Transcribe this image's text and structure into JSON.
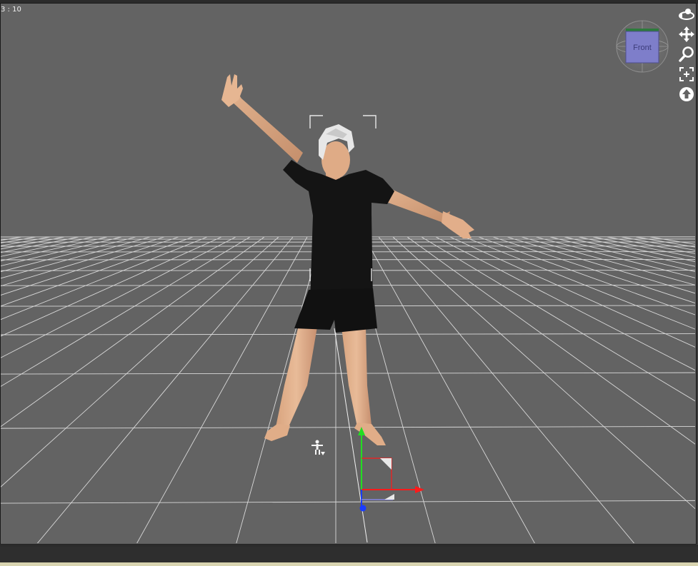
{
  "viewport": {
    "fps_text": "3 : 10",
    "view_cube_label": "Front",
    "background_color": "#636363",
    "grid_color": "#d6d6d6"
  },
  "nav_tools": [
    {
      "name": "orbit-icon",
      "icon": "orbit"
    },
    {
      "name": "pan-icon",
      "icon": "move-arrows"
    },
    {
      "name": "zoom-icon",
      "icon": "magnifier"
    },
    {
      "name": "frame-icon",
      "icon": "frame-brackets"
    },
    {
      "name": "reset-view-icon",
      "icon": "up-arrow-circle"
    }
  ],
  "gizmo_colors": {
    "x": "#ff1a1a",
    "y": "#22dd22",
    "z": "#1a3cff"
  }
}
